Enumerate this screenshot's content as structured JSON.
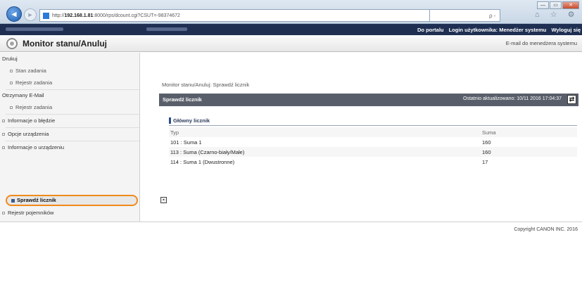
{
  "browser": {
    "url_prefix": "http://",
    "url_host": "192.168.1.81",
    "url_path": ":8000/rps/dcount.cgi?CSUT=-98374672",
    "search_glyph": "ρ - c",
    "toolbar_glyphs": "⌂ ☆ ⚙",
    "window_buttons": {
      "min": "—",
      "max": "▭",
      "close": "✕"
    }
  },
  "topbar": {
    "links": [
      "Do portalu",
      "Login użytkownika: Menedżer systemu",
      "Wyloguj się"
    ]
  },
  "header": {
    "title": "Monitor stanu/Anuluj",
    "mail_link": "E-mail do menedżera systemu"
  },
  "sidebar": {
    "items": [
      {
        "label": "Drukuj",
        "type": "heading"
      },
      {
        "label": "Stan zadania",
        "type": "sub"
      },
      {
        "label": "Rejestr zadania",
        "type": "sub"
      },
      {
        "label": "Otrzymany E-Mail",
        "type": "heading"
      },
      {
        "label": "Rejestr zadania",
        "type": "sub"
      },
      {
        "label": "Informacje o błędzie",
        "type": "link"
      },
      {
        "label": "Opcje urządzenia",
        "type": "link"
      },
      {
        "label": "Informacje o urządzeniu",
        "type": "link"
      },
      {
        "label": "Sprawdź licznik",
        "type": "active"
      },
      {
        "label": "Rejestr pojemników",
        "type": "link"
      }
    ]
  },
  "main": {
    "breadcrumb": "Monitor stanu/Anuluj: Sprawdź licznik",
    "section_title": "Sprawdź licznik",
    "last_updated": "Ostatnio aktualizowano: 10/11 2016 17:04:37",
    "refresh_glyph": "⇄",
    "group_title": "Główny licznik",
    "table": {
      "headers": [
        "Typ",
        "Suma"
      ],
      "rows": [
        [
          "101 : Suma 1",
          "160"
        ],
        [
          "113 : Suma (Czarno-biały/Małe)",
          "160"
        ],
        [
          "114 : Suma 1 (Dwustronne)",
          "17"
        ]
      ]
    },
    "collapse_glyph": "▪"
  },
  "footer": {
    "copyright": "Copyright CANON INC. 2016"
  },
  "colors": {
    "accent_highlight": "#f08a1a",
    "topbar": "#1e2f52",
    "section_bar": "#595f6a"
  }
}
